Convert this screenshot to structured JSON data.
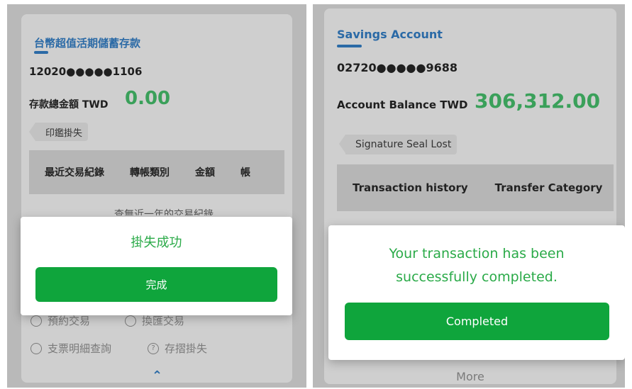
{
  "left": {
    "title": "台幣超值活期儲蓄存款",
    "account_number": "12020●●●●●1106",
    "balance_label": "存款總金額 TWD",
    "balance_value": "0.00",
    "tag": "印鑑掛失",
    "tabs": [
      "最近交易紀錄",
      "轉帳類別",
      "金額",
      "帳"
    ],
    "partial_text": "查無近一年的交易紀錄",
    "dialog_message": "掛失成功",
    "dialog_button": "完成",
    "actions": [
      {
        "icon": "search-icon",
        "label": "預約交易"
      },
      {
        "icon": "exchange-icon",
        "label": "換匯交易"
      },
      {
        "icon": "search-icon",
        "label": "支票明細查詢"
      },
      {
        "icon": "question-icon",
        "label": "存摺掛失"
      }
    ],
    "chevron": "^"
  },
  "right": {
    "title": "Savings Account",
    "account_number": "02720●●●●●9688",
    "balance_label": "Account Balance TWD",
    "balance_value": "306,312.00",
    "tag": "Signature Seal Lost",
    "tabs": [
      "Transaction history",
      "Transfer Category"
    ],
    "dialog_message": "Your transaction has been successfully completed.",
    "dialog_button": "Completed",
    "more": "More"
  },
  "colors": {
    "title_blue": "#2b6aa6",
    "balance_green": "#3aa05a",
    "button_green": "#0fa53c",
    "message_green": "#2aaa48"
  }
}
